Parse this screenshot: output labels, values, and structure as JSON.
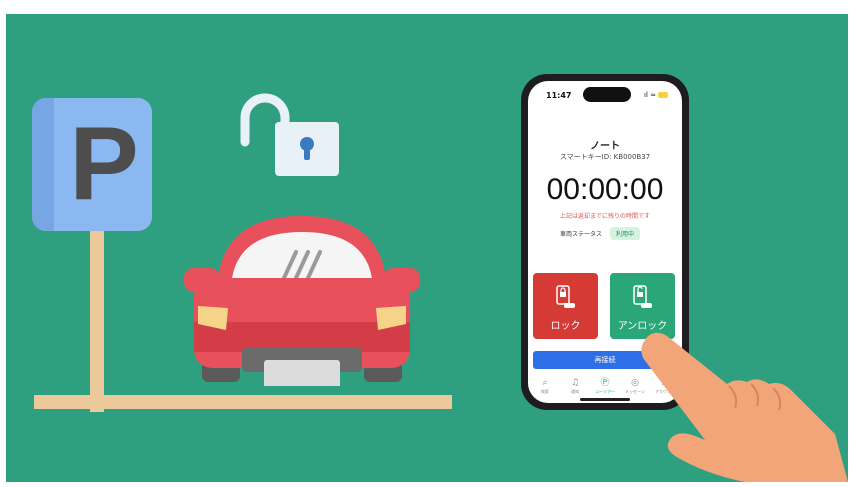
{
  "sign": {
    "letter": "P"
  },
  "phone": {
    "status_time": "11:47",
    "status_icons": "ıl ≈",
    "car_name": "ノート",
    "key_id": "スマートキーID: KB000B37",
    "timer": "00:00:00",
    "timer_note": "上記は返却までに残りの時間です",
    "vehicle_status_label": "車両ステータス",
    "vehicle_status_value": "利用中",
    "lock_label": "ロック",
    "unlock_label": "アンロック",
    "reconnect_label": "再接続",
    "tabs": [
      {
        "glyph": "⌕",
        "label": "検索"
      },
      {
        "glyph": "♫",
        "label": "通知"
      },
      {
        "glyph": "Ⓟ",
        "label": "コーリアー"
      },
      {
        "glyph": "◎",
        "label": "メッセージ"
      },
      {
        "glyph": "♙",
        "label": "アカウント"
      }
    ],
    "active_tab": 2
  },
  "colors": {
    "background": "#2fa07f",
    "lock_button": "#d63a34",
    "unlock_button": "#2aa679",
    "reconnect_button": "#2d6fe6",
    "car_body": "#e8505b",
    "sign": "#8bb8f0"
  },
  "icons": [
    "parking-sign-icon",
    "open-padlock-icon",
    "car-icon",
    "smartphone",
    "pointing-hand-icon"
  ]
}
